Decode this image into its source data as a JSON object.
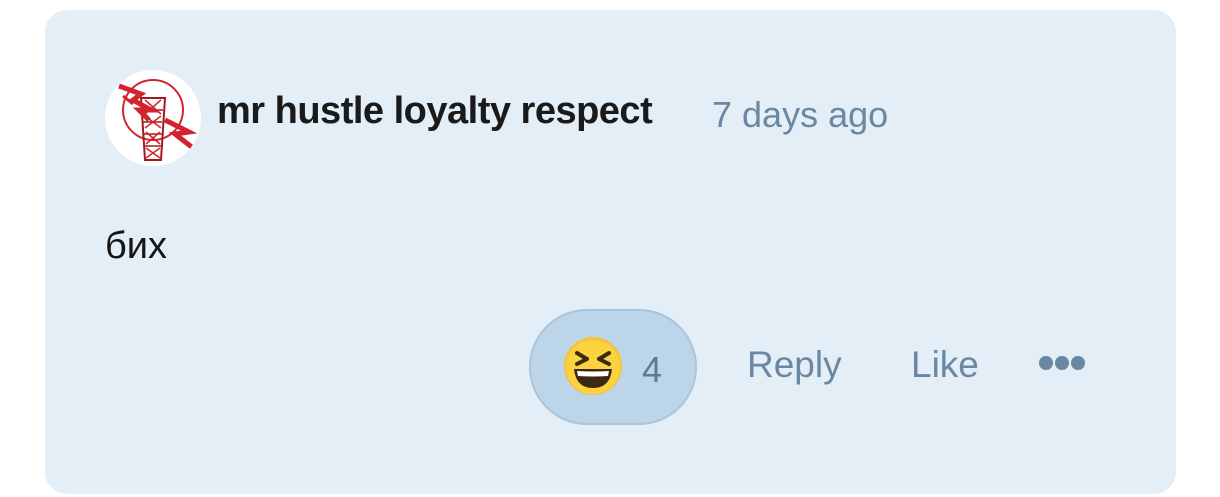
{
  "comment": {
    "author": "mr hustle loyalty respect",
    "timestamp": "7 days ago",
    "text": "бих",
    "avatar_icon": "hustle-loyalty-respect-logo-icon"
  },
  "reactions": {
    "emoji_icon": "grinning-squinting-face-icon",
    "count": "4"
  },
  "actions": {
    "reply_label": "Reply",
    "like_label": "Like",
    "more_icon": "more-horizontal-icon"
  },
  "colors": {
    "card_background": "#e3eef6",
    "reaction_pill": "#bcd5e9",
    "muted_text": "#6a87a3",
    "logo_red": "#d3232e"
  }
}
